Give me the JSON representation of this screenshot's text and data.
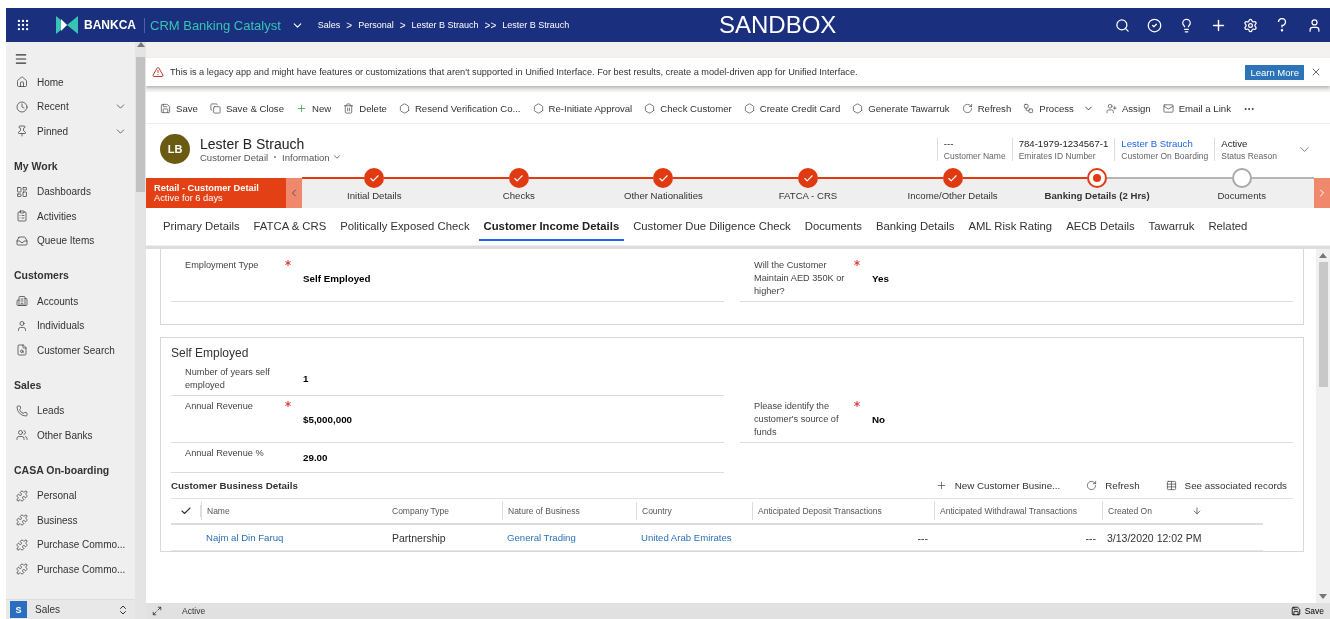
{
  "nav": {
    "brand": "BANKCA",
    "app_name": "CRM Banking Catalyst",
    "breadcrumbs": [
      {
        "label": "Sales"
      },
      {
        "label": "Personal",
        "separator": ">"
      },
      {
        "label": "Lester B Strauch",
        "separator": ">"
      },
      {
        "label": "Lester B Strauch",
        "separator": ">>"
      }
    ],
    "environment": "SANDBOX"
  },
  "sidebar": {
    "groups": [
      {
        "items": [
          {
            "label": "Home",
            "expandable": false
          },
          {
            "label": "Recent",
            "expandable": true
          },
          {
            "label": "Pinned",
            "expandable": true
          }
        ]
      },
      {
        "title": "My Work",
        "items": [
          {
            "label": "Dashboards",
            "expandable": false
          },
          {
            "label": "Activities",
            "expandable": false
          },
          {
            "label": "Queue Items",
            "expandable": false
          }
        ]
      },
      {
        "title": "Customers",
        "items": [
          {
            "label": "Accounts",
            "expandable": false
          },
          {
            "label": "Individuals",
            "expandable": false
          },
          {
            "label": "Customer Search",
            "expandable": false
          }
        ]
      },
      {
        "title": "Sales",
        "items": [
          {
            "label": "Leads",
            "expandable": false
          },
          {
            "label": "Other Banks",
            "expandable": false
          }
        ]
      },
      {
        "title": "CASA On-boarding",
        "items": [
          {
            "label": "Personal",
            "expandable": false
          },
          {
            "label": "Business",
            "expandable": false
          },
          {
            "label": "Purchase Commo...",
            "expandable": false
          },
          {
            "label": "Purchase Commo...",
            "expandable": false
          }
        ]
      }
    ],
    "area": {
      "badge": "S",
      "label": "Sales"
    }
  },
  "notification": {
    "text": "This is a legacy app and might have features or customizations that aren't supported in Unified Interface. For best results, create a model-driven app for Unified Interface.",
    "button": "Learn More"
  },
  "commands": [
    {
      "label": "Save",
      "has_dropdown": false
    },
    {
      "label": "Save & Close",
      "has_dropdown": false
    },
    {
      "label": "New",
      "has_dropdown": false
    },
    {
      "label": "Delete",
      "has_dropdown": false
    },
    {
      "label": "Resend Verification Co...",
      "has_dropdown": false
    },
    {
      "label": "Re-Initiate Approval",
      "has_dropdown": false
    },
    {
      "label": "Check Customer",
      "has_dropdown": false
    },
    {
      "label": "Create Credit Card",
      "has_dropdown": false
    },
    {
      "label": "Generate Tawarruk",
      "has_dropdown": false
    },
    {
      "label": "Refresh",
      "has_dropdown": false
    },
    {
      "label": "Process",
      "has_dropdown": true
    },
    {
      "label": "Assign",
      "has_dropdown": false
    },
    {
      "label": "Email a Link",
      "has_dropdown": false
    }
  ],
  "header": {
    "avatar": "LB",
    "title": "Lester B Strauch",
    "form": "Customer Detail",
    "view": "Information",
    "fields": [
      {
        "value": "---",
        "label": "Customer Name",
        "kind": "text"
      },
      {
        "value": "784-1979-1234567-1",
        "label": "Emirates ID Number",
        "kind": "text"
      },
      {
        "value": "Lester B Strauch",
        "label": "Customer On Boarding",
        "kind": "link"
      },
      {
        "value": "Active",
        "label": "Status Reason",
        "kind": "text"
      }
    ]
  },
  "process": {
    "title": "Retail - Customer Detail",
    "subtitle": "Active for 6 days",
    "stages": [
      {
        "label": "Initial Details",
        "completed": true,
        "active": false
      },
      {
        "label": "Checks",
        "completed": true,
        "active": false
      },
      {
        "label": "Other Nationalities",
        "completed": true,
        "active": false
      },
      {
        "label": "FATCA - CRS",
        "completed": true,
        "active": false
      },
      {
        "label": "Income/Other Details",
        "completed": true,
        "active": false
      },
      {
        "label": "Banking Details",
        "duration": "(2 Hrs)",
        "completed": false,
        "active": true
      },
      {
        "label": "Documents",
        "completed": false,
        "active": false
      }
    ]
  },
  "tabs": [
    {
      "label": "Primary Details",
      "selected": false
    },
    {
      "label": "FATCA & CRS",
      "selected": false
    },
    {
      "label": "Politically Exposed Check",
      "selected": false
    },
    {
      "label": "Customer Income Details",
      "selected": true
    },
    {
      "label": "Customer Due Diligence Check",
      "selected": false
    },
    {
      "label": "Documents",
      "selected": false
    },
    {
      "label": "Banking Details",
      "selected": false
    },
    {
      "label": "AML Risk Rating",
      "selected": false
    },
    {
      "label": "AECB Details",
      "selected": false
    },
    {
      "label": "Tawarruk",
      "selected": false
    },
    {
      "label": "Related",
      "selected": false
    }
  ],
  "sections": [
    {
      "rows": [
        {
          "left": {
            "label": "Employment Type",
            "required": true,
            "value": "Self Employed"
          },
          "right": {
            "label": "Will the Customer Maintain AED 350K or higher?",
            "required": true,
            "value": "Yes"
          }
        }
      ]
    },
    {
      "title": "Self Employed",
      "rows": [
        {
          "left": {
            "label": "Number of years self employed",
            "required": false,
            "value": "1"
          },
          "right": null
        },
        {
          "left": {
            "label": "Annual Revenue",
            "required": true,
            "value": "$5,000,000"
          },
          "right": {
            "label": "Please identify the customer's source of funds",
            "required": true,
            "value": "No"
          }
        },
        {
          "left": {
            "label": "Annual Revenue %",
            "required": false,
            "value": "29.00"
          },
          "right": null
        }
      ]
    }
  ],
  "subgrid": {
    "title": "Customer Business Details",
    "commands": [
      "New Customer Busine...",
      "Refresh",
      "See associated records"
    ],
    "columns": [
      "Name",
      "Company Type",
      "Nature of Business",
      "Country",
      "Anticipated Deposit Transactions",
      "Anticipated Withdrawal Transactions",
      "Created On"
    ],
    "rows": [
      {
        "cells": [
          {
            "text": "Najm al Din Faruq",
            "kind": "link"
          },
          {
            "text": "Partnership",
            "kind": "text"
          },
          {
            "text": "General Trading",
            "kind": "link"
          },
          {
            "text": "United Arab Emirates",
            "kind": "link"
          },
          {
            "text": "---",
            "kind": "number"
          },
          {
            "text": "---",
            "kind": "number"
          },
          {
            "text": "3/13/2020 12:02 PM",
            "kind": "text"
          }
        ]
      }
    ]
  },
  "status_bar": {
    "status": "Active",
    "save": "Save"
  }
}
